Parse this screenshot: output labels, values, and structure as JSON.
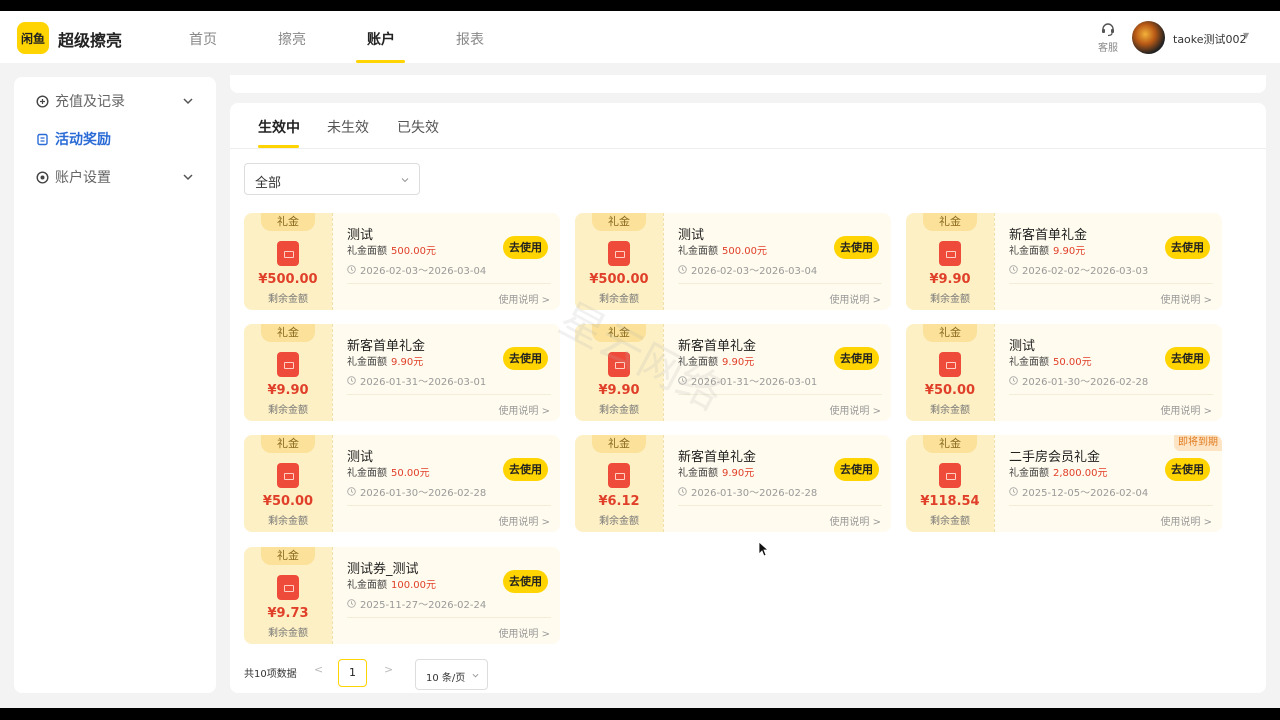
{
  "header": {
    "logo_text": "闲鱼",
    "brand": "超级擦亮",
    "nav": [
      "首页",
      "擦亮",
      "账户",
      "报表"
    ],
    "service_label": "客服",
    "username": "taoke测试002"
  },
  "sidebar": {
    "items": [
      {
        "label": "充值及记录",
        "icon": "recharge-icon"
      },
      {
        "label": "活动奖励",
        "icon": "reward-icon"
      },
      {
        "label": "账户设置",
        "icon": "settings-icon"
      }
    ]
  },
  "tabs": [
    "生效中",
    "未生效",
    "已失效"
  ],
  "filter": {
    "value": "全部"
  },
  "coupon_labels": {
    "tag": "礼金",
    "remaining": "剩余金额",
    "face_label": "礼金面额",
    "use_button": "去使用",
    "help": "使用说明 >"
  },
  "coupons": [
    {
      "title": "测试",
      "face": "500.00元",
      "amount": "¥500.00",
      "dates": "2026-02-03～2026-03-04",
      "badge": ""
    },
    {
      "title": "测试",
      "face": "500.00元",
      "amount": "¥500.00",
      "dates": "2026-02-03～2026-03-04",
      "badge": ""
    },
    {
      "title": "新客首单礼金",
      "face": "9.90元",
      "amount": "¥9.90",
      "dates": "2026-02-02～2026-03-03",
      "badge": ""
    },
    {
      "title": "新客首单礼金",
      "face": "9.90元",
      "amount": "¥9.90",
      "dates": "2026-01-31～2026-03-01",
      "badge": ""
    },
    {
      "title": "新客首单礼金",
      "face": "9.90元",
      "amount": "¥9.90",
      "dates": "2026-01-31～2026-03-01",
      "badge": ""
    },
    {
      "title": "测试",
      "face": "50.00元",
      "amount": "¥50.00",
      "dates": "2026-01-30～2026-02-28",
      "badge": ""
    },
    {
      "title": "测试",
      "face": "50.00元",
      "amount": "¥50.00",
      "dates": "2026-01-30～2026-02-28",
      "badge": ""
    },
    {
      "title": "新客首单礼金",
      "face": "9.90元",
      "amount": "¥6.12",
      "dates": "2026-01-30～2026-02-28",
      "badge": ""
    },
    {
      "title": "二手房会员礼金",
      "face": "2,800.00元",
      "amount": "¥118.54",
      "dates": "2025-12-05～2026-02-04",
      "badge": "即将到期"
    },
    {
      "title": "测试券_测试",
      "face": "100.00元",
      "amount": "¥9.73",
      "dates": "2025-11-27～2026-02-24",
      "badge": ""
    }
  ],
  "pagination": {
    "total": "共10项数据",
    "prev": "<",
    "page": "1",
    "next": ">",
    "page_size": "10 条/页"
  },
  "colors": {
    "accent": "#ffd400",
    "active_link": "#2a6bd6",
    "amount_red": "#e0402a"
  }
}
